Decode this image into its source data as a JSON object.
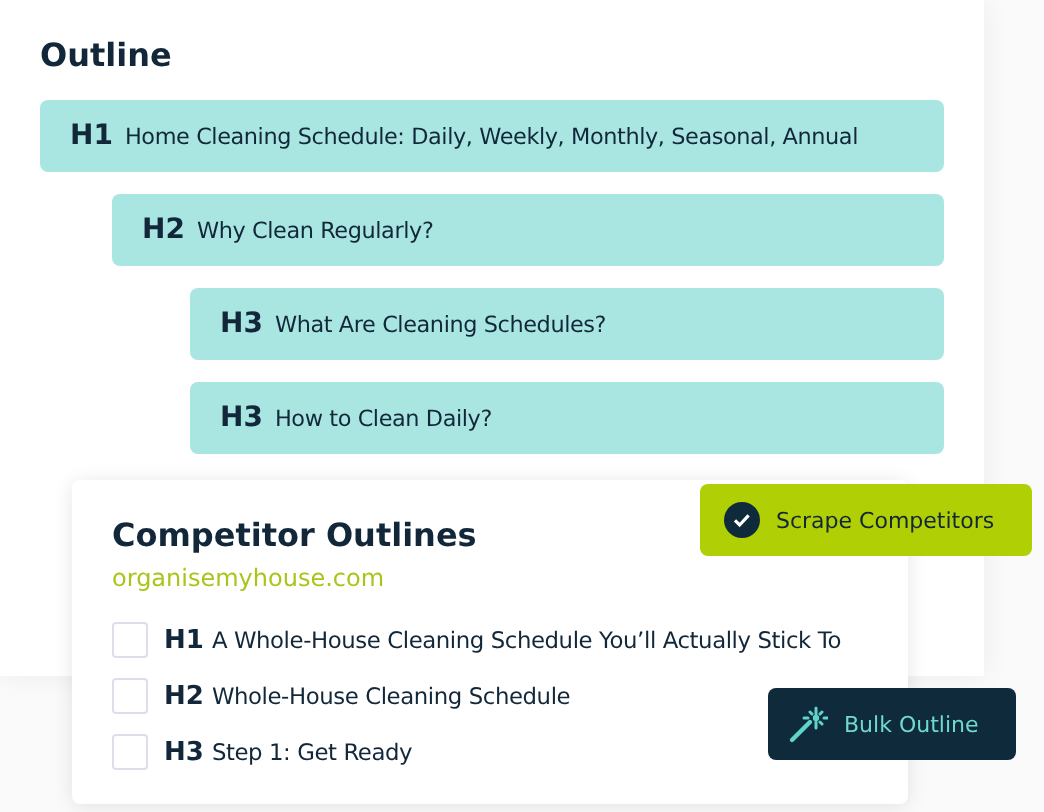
{
  "outline": {
    "title": "Outline",
    "items": [
      {
        "level": "H1",
        "text": "Home Cleaning Schedule: Daily, Weekly, Monthly, Seasonal, Annual",
        "children": [
          {
            "level": "H2",
            "text": "Why Clean Regularly?",
            "children": [
              {
                "level": "H3",
                "text": "What Are Cleaning Schedules?"
              },
              {
                "level": "H3",
                "text": "How to Clean Daily?"
              }
            ]
          }
        ]
      }
    ]
  },
  "competitor_outlines": {
    "title": "Competitor Outlines",
    "source": "organisemyhouse.com",
    "headings": [
      {
        "level": "H1",
        "text": "A Whole-House Cleaning Schedule You’ll Actually Stick To",
        "checked": false
      },
      {
        "level": "H2",
        "text": "Whole-House Cleaning Schedule",
        "checked": false
      },
      {
        "level": "H3",
        "text": "Step 1: Get Ready",
        "checked": false
      }
    ]
  },
  "buttons": [
    {
      "label": "Scrape Competitors",
      "kind": "scrape"
    },
    {
      "label": "Bulk Outline",
      "kind": "bulk"
    }
  ]
}
